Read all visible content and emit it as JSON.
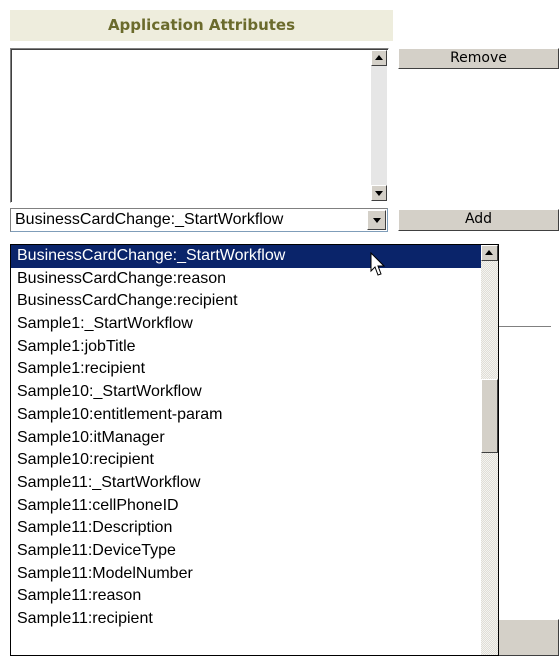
{
  "section": {
    "title": "Application Attributes"
  },
  "buttons": {
    "remove_label": "Remove",
    "add_label": "Add"
  },
  "select": {
    "value": "BusinessCardChange:_StartWorkflow"
  },
  "dropdown": {
    "items": [
      "BusinessCardChange:_StartWorkflow",
      "BusinessCardChange:reason",
      "BusinessCardChange:recipient",
      "Sample1:_StartWorkflow",
      "Sample1:jobTitle",
      "Sample1:recipient",
      "Sample10:_StartWorkflow",
      "Sample10:entitlement-param",
      "Sample10:itManager",
      "Sample10:recipient",
      "Sample11:_StartWorkflow",
      "Sample11:cellPhoneID",
      "Sample11:Description",
      "Sample11:DeviceType",
      "Sample11:ModelNumber",
      "Sample11:reason",
      "Sample11:recipient"
    ],
    "selected_index": 0
  },
  "colors": {
    "header_bg": "#eeeddd",
    "header_text": "#6b6b2c",
    "selection_bg": "#0a246a",
    "button_face": "#d4d0c8"
  },
  "icons": {
    "scroll_up": "scroll-up-arrow-icon",
    "scroll_down": "scroll-down-arrow-icon",
    "dropdown_arrow": "chevron-down-icon",
    "cursor": "mouse-pointer-icon"
  }
}
